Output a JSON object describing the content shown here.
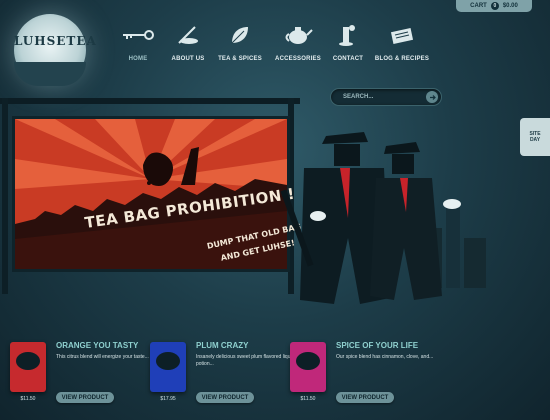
{
  "brand": {
    "logo_text": "LUHSETEA"
  },
  "cart": {
    "label": "CART",
    "count": "0",
    "total": "$0.00"
  },
  "nav": {
    "items": [
      {
        "label": "HOME",
        "icon": "key-icon",
        "active": true
      },
      {
        "label": "ABOUT US",
        "icon": "fountain-pen-icon",
        "active": false
      },
      {
        "label": "TEA & SPICES",
        "icon": "leaf-icon",
        "active": false
      },
      {
        "label": "ACCESSORIES",
        "icon": "teapot-icon",
        "active": false
      },
      {
        "label": "CONTACT",
        "icon": "telephone-icon",
        "active": false
      },
      {
        "label": "BLOG & RECIPES",
        "icon": "newspaper-icon",
        "active": false
      }
    ]
  },
  "search": {
    "label": "SEARCH..."
  },
  "side_tab": {
    "line1": "SITE",
    "line2": "DAY"
  },
  "hero": {
    "title": "TEA BAG PROHIBITION !",
    "line1": "DUMP THAT OLD BAG",
    "line2": "AND GET LUHSE!"
  },
  "products": [
    {
      "title": "ORANGE YOU TASTY",
      "description": "This citrus blend will energize your taste...",
      "price": "$11.50",
      "button": "VIEW PRODUCT",
      "color": "#c62a2e"
    },
    {
      "title": "PLUM CRAZY",
      "description": "Insanely delicious sweet plum flavored liquid potion...",
      "price": "$17.95",
      "button": "VIEW PRODUCT",
      "color": "#1f3fb8"
    },
    {
      "title": "SPICE OF YOUR LIFE",
      "description": "Our spice blend has cinnamon, clove, and...",
      "price": "$11.50",
      "button": "VIEW PRODUCT",
      "color": "#c0287a"
    }
  ],
  "colors": {
    "accent": "#8fd0cf",
    "poster_red": "#c93b24",
    "background": "#1d3d49"
  }
}
